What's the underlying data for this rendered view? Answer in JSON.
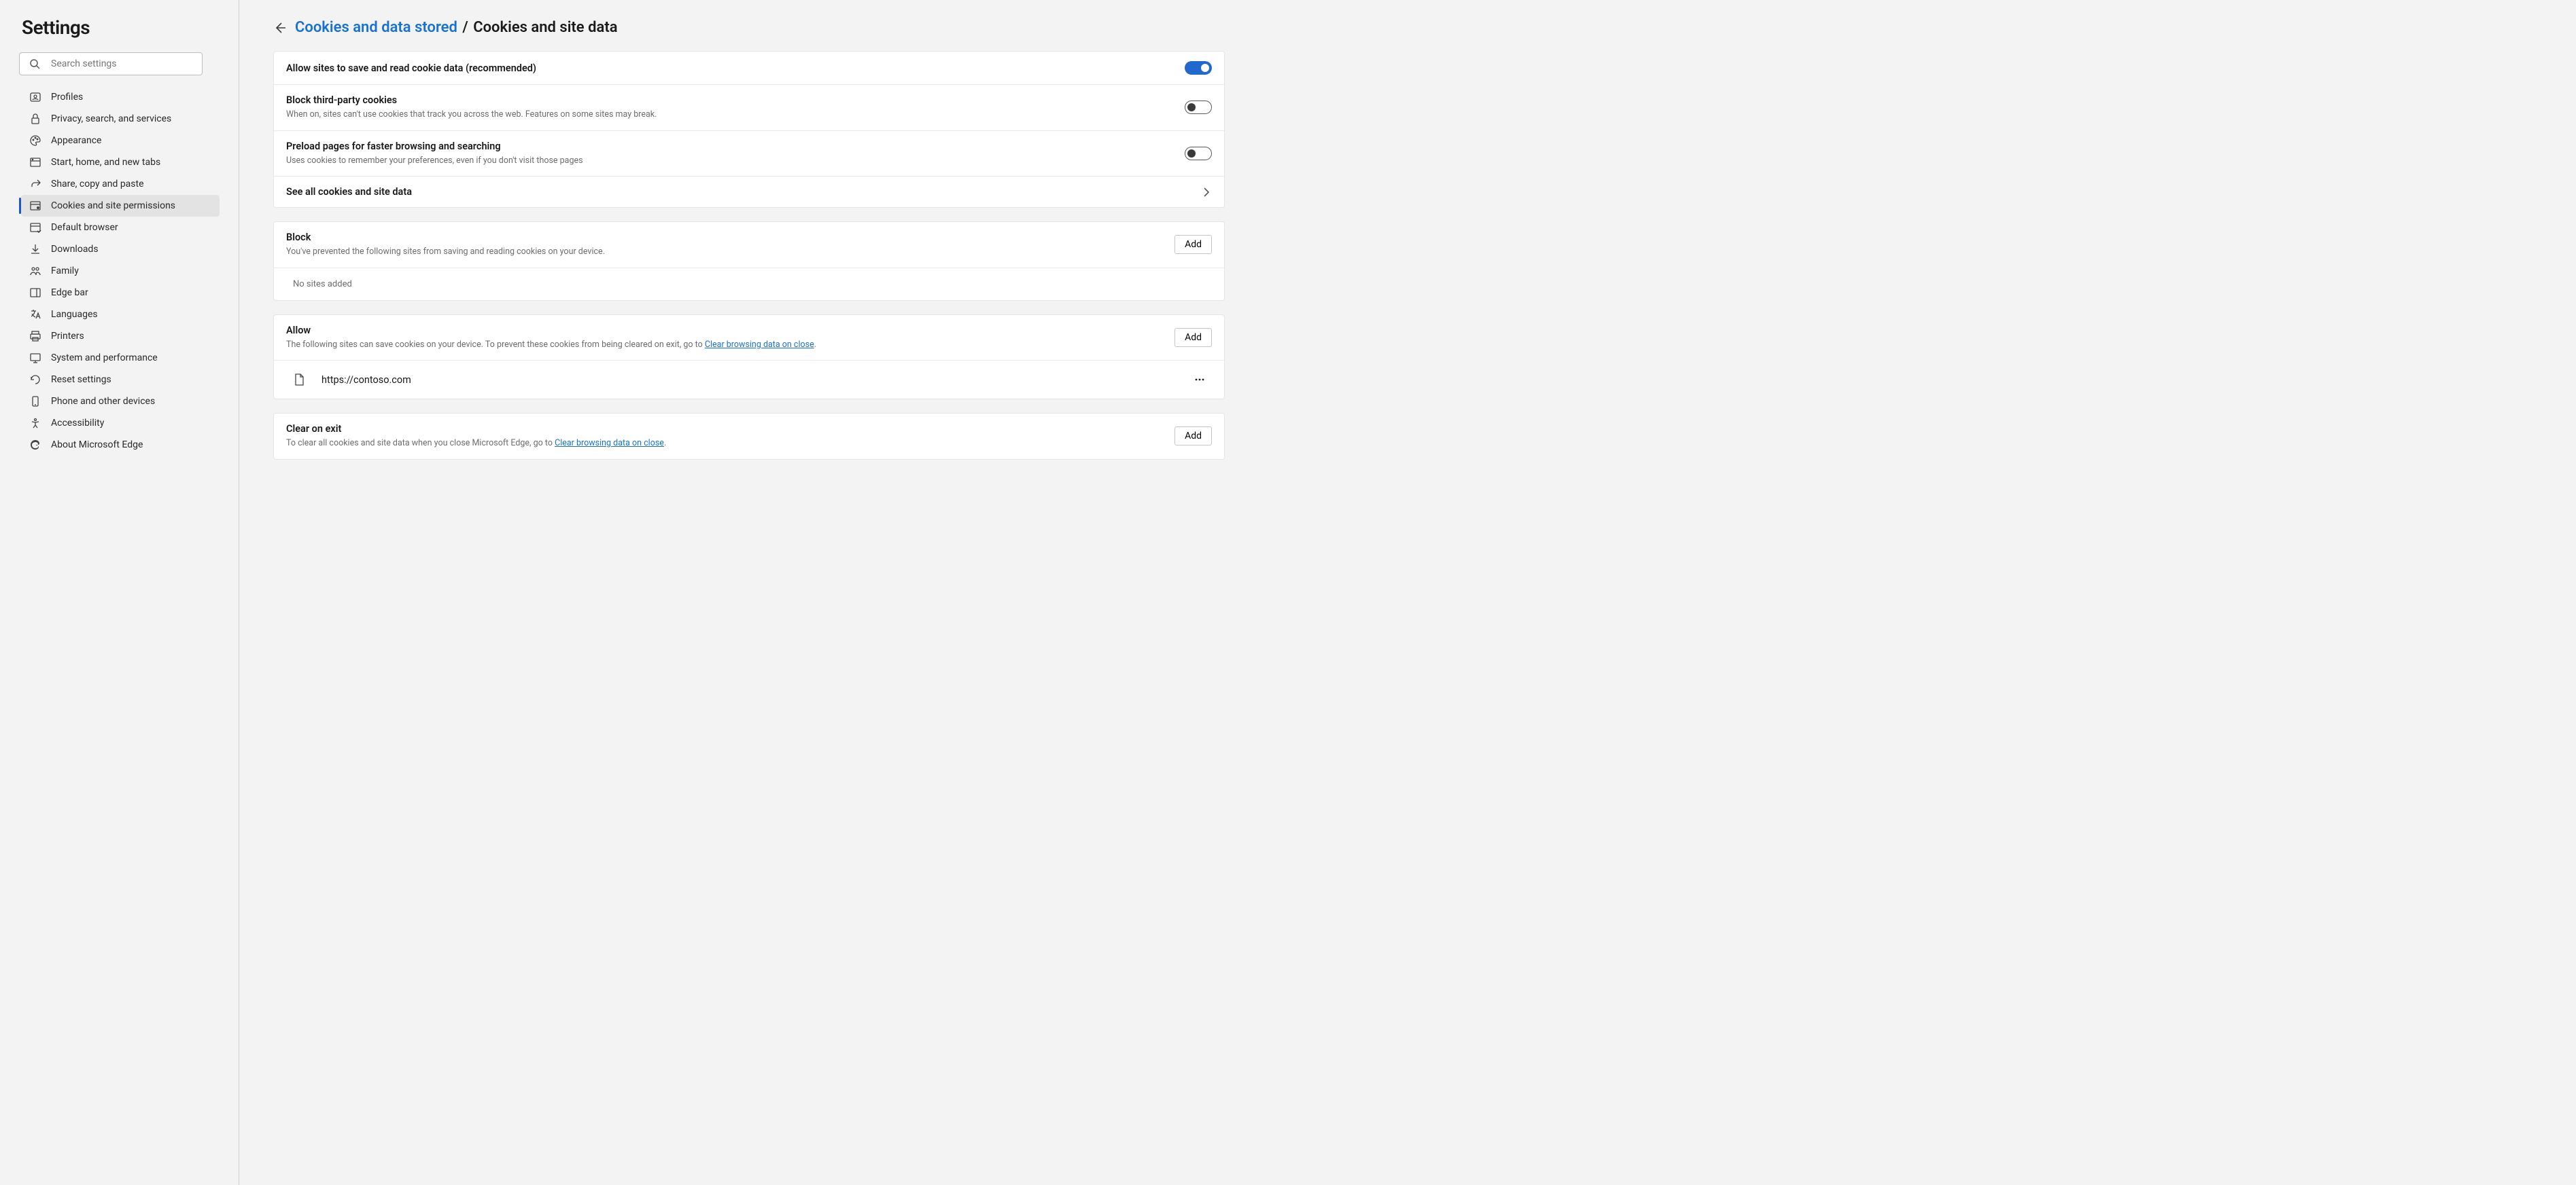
{
  "sidebar": {
    "title": "Settings",
    "search_placeholder": "Search settings",
    "items": [
      {
        "label": "Profiles",
        "icon": "profile"
      },
      {
        "label": "Privacy, search, and services",
        "icon": "lock"
      },
      {
        "label": "Appearance",
        "icon": "palette"
      },
      {
        "label": "Start, home, and new tabs",
        "icon": "window"
      },
      {
        "label": "Share, copy and paste",
        "icon": "share"
      },
      {
        "label": "Cookies and site permissions",
        "icon": "cookie",
        "active": true
      },
      {
        "label": "Default browser",
        "icon": "defaultbrowser"
      },
      {
        "label": "Downloads",
        "icon": "download"
      },
      {
        "label": "Family",
        "icon": "family"
      },
      {
        "label": "Edge bar",
        "icon": "edgebar"
      },
      {
        "label": "Languages",
        "icon": "language"
      },
      {
        "label": "Printers",
        "icon": "printer"
      },
      {
        "label": "System and performance",
        "icon": "system"
      },
      {
        "label": "Reset settings",
        "icon": "reset"
      },
      {
        "label": "Phone and other devices",
        "icon": "phone"
      },
      {
        "label": "Accessibility",
        "icon": "accessibility"
      },
      {
        "label": "About Microsoft Edge",
        "icon": "edge"
      }
    ]
  },
  "breadcrumb": {
    "parent": "Cookies and data stored",
    "sep": "/",
    "current": "Cookies and site data"
  },
  "settings": {
    "allow_cookies": {
      "title": "Allow sites to save and read cookie data (recommended)",
      "on": true
    },
    "block_third_party": {
      "title": "Block third-party cookies",
      "sub": "When on, sites can't use cookies that track you across the web. Features on some sites may break.",
      "on": false
    },
    "preload": {
      "title": "Preload pages for faster browsing and searching",
      "sub": "Uses cookies to remember your preferences, even if you don't visit those pages",
      "on": false
    },
    "see_all": {
      "title": "See all cookies and site data"
    }
  },
  "sections": {
    "block": {
      "title": "Block",
      "sub": "You've prevented the following sites from saving and reading cookies on your device.",
      "add": "Add",
      "empty": "No sites added"
    },
    "allow": {
      "title": "Allow",
      "sub_prefix": "The following sites can save cookies on your device. To prevent these cookies from being cleared on exit, go to ",
      "sub_link": "Clear browsing data on close",
      "sub_suffix": ".",
      "add": "Add",
      "sites": [
        {
          "url": "https://contoso.com"
        }
      ]
    },
    "clear_on_exit": {
      "title": "Clear on exit",
      "sub_prefix": "To clear all cookies and site data when you close Microsoft Edge, go to ",
      "sub_link": "Clear browsing data on close",
      "sub_suffix": ".",
      "add": "Add"
    }
  }
}
